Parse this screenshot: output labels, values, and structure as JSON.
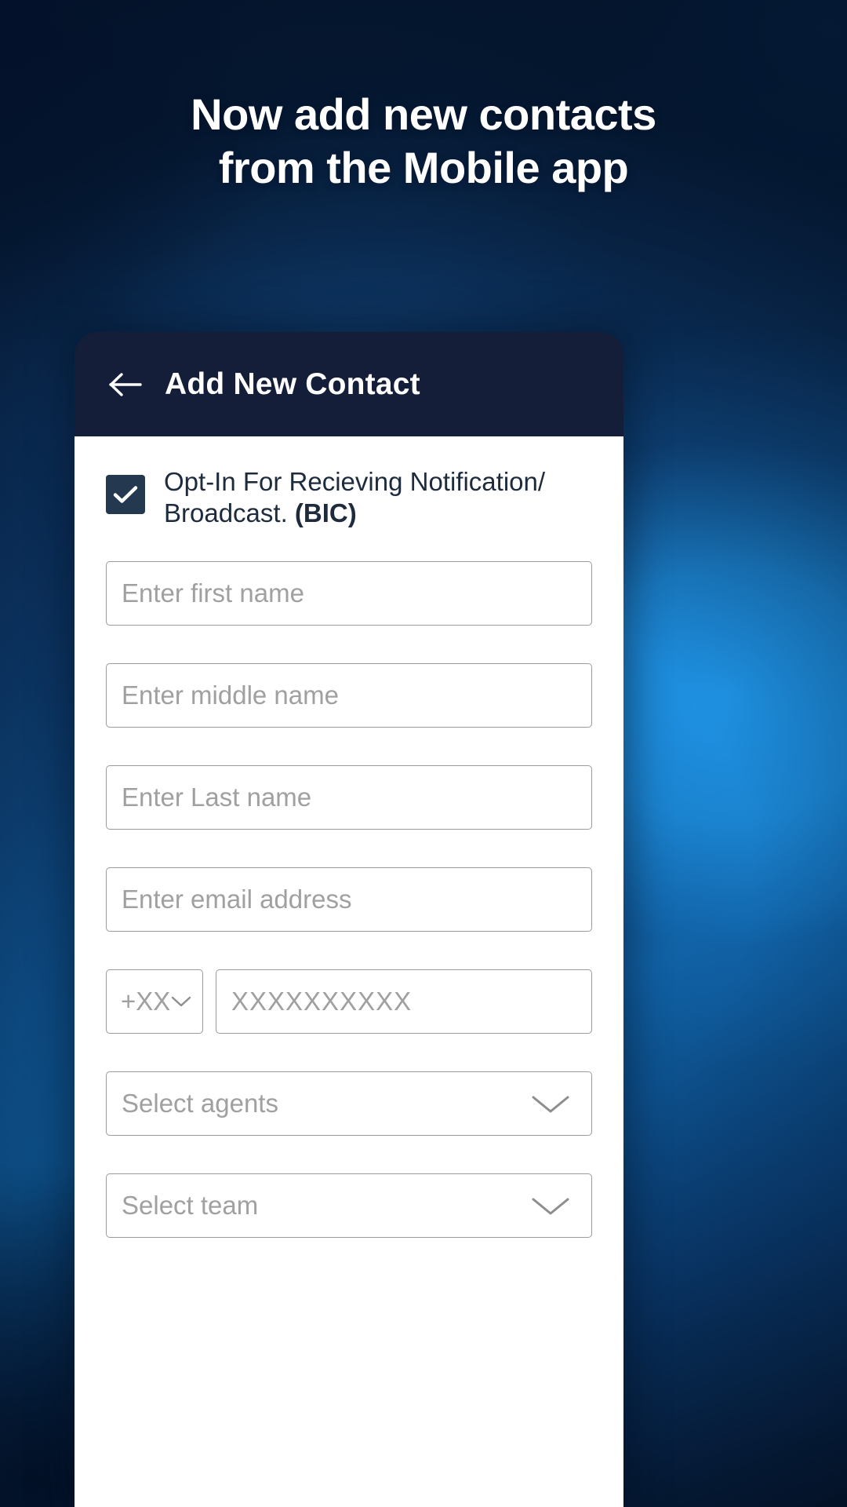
{
  "promo": {
    "headline_line1": "Now add new contacts",
    "headline_line2": "from the Mobile app",
    "text_color": "#ffffff",
    "background_colors": [
      "#08234a",
      "#0d3f72",
      "#1f94e6",
      "#061a36"
    ]
  },
  "app": {
    "appbar": {
      "back_icon": "arrow-left-icon",
      "title": "Add New Contact",
      "background_color": "#141e38",
      "text_color": "#ffffff"
    },
    "form": {
      "background_color": "#ffffff",
      "optin": {
        "checked": true,
        "checkbox_color": "#24384f",
        "check_icon": "check-icon",
        "label_part1": "Opt-In For Recieving Notification/ Broadcast. ",
        "label_bold": "(BIC)",
        "label_full": "Opt-In For Recieving Notification/ Broadcast. (BIC)"
      },
      "fields": [
        {
          "name": "first-name",
          "value": "",
          "placeholder": "Enter first name"
        },
        {
          "name": "middle-name",
          "value": "",
          "placeholder": "Enter middle name"
        },
        {
          "name": "last-name",
          "value": "",
          "placeholder": "Enter Last name"
        },
        {
          "name": "email",
          "value": "",
          "placeholder": "Enter email address"
        }
      ],
      "phone": {
        "country_code_value": "+XX",
        "country_code_icon": "chevron-down-icon",
        "number_placeholder": "XXXXXXXXXX"
      },
      "selects": [
        {
          "name": "agents",
          "value": "",
          "placeholder": "Select agents",
          "icon": "chevron-down-icon"
        },
        {
          "name": "team",
          "value": "",
          "placeholder": "Select team",
          "icon": "chevron-down-icon"
        }
      ],
      "placeholder_color": "#a0a0a0",
      "border_color": "#9b9b9b"
    }
  }
}
